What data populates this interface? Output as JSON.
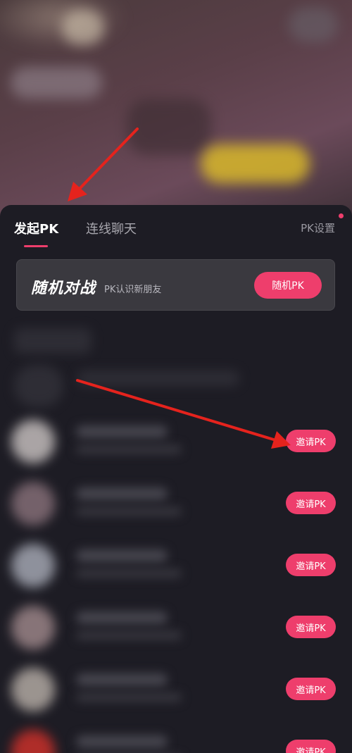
{
  "tabs": {
    "launch_pk": "发起PK",
    "link_chat": "连线聊天",
    "settings": "PK设置"
  },
  "random_battle": {
    "title": "随机对战",
    "subtitle": "PK认识新朋友",
    "button": "随机PK"
  },
  "anchor_list": {
    "invite_label": "邀请PK",
    "rows": [
      {
        "invite_label": "邀请PK"
      },
      {
        "invite_label": "邀请PK"
      },
      {
        "invite_label": "邀请PK"
      },
      {
        "invite_label": "邀请PK"
      },
      {
        "invite_label": "邀请PK"
      },
      {
        "invite_label": "邀请PK"
      }
    ]
  },
  "colors": {
    "accent": "#ee3e6c",
    "panel_bg": "#1d1c24",
    "card_bg": "#3a393f",
    "annotation_arrow": "#e5231d"
  }
}
